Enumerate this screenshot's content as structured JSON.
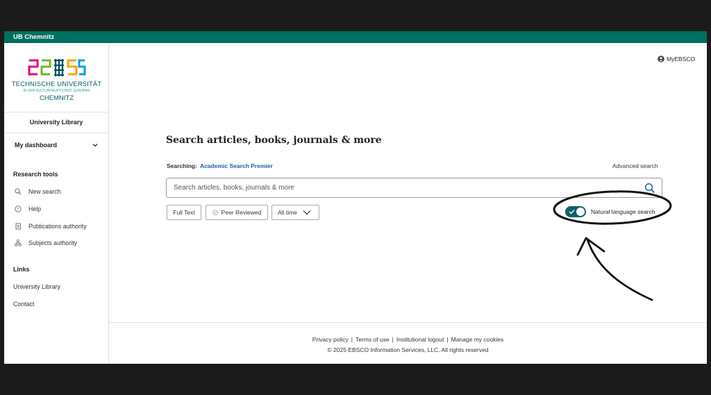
{
  "topbar": {
    "title": "UB Chemnitz"
  },
  "logo": {
    "line1": "TECHNISCHE UNIVERSITÄT",
    "line2": "IN DER KULTURHAUPTSTADT EUROPAS",
    "line3": "CHEMNITZ"
  },
  "sidebar": {
    "library_title": "University Library",
    "dashboard_label": "My dashboard",
    "research_tools_heading": "Research tools",
    "research_tools": [
      {
        "label": "New search",
        "icon": "search-icon"
      },
      {
        "label": "Help",
        "icon": "help-icon"
      },
      {
        "label": "Publications authority",
        "icon": "book-icon"
      },
      {
        "label": "Subjects authority",
        "icon": "hierarchy-icon"
      }
    ],
    "links_heading": "Links",
    "links": [
      {
        "label": "University Library"
      },
      {
        "label": "Contact"
      }
    ]
  },
  "header": {
    "account_label": "MyEBSCO"
  },
  "main": {
    "heading": "Search articles, books, journals & more",
    "searching_label": "Searching:",
    "database": "Academic Search Premier",
    "advanced_search": "Advanced search",
    "search": {
      "placeholder": "Search articles, books, journals & more",
      "value": ""
    },
    "filters": {
      "full_text": "Full Text",
      "peer_reviewed": "Peer Reviewed",
      "time": "All time"
    },
    "natural_language": {
      "label": "Natural language search",
      "enabled": true
    }
  },
  "footer": {
    "links": [
      "Privacy policy",
      "Terms of use",
      "Institutional logout",
      "Manage my cookies"
    ],
    "copyright": "© 2025 EBSCO Information Services, LLC. All rights reserved"
  },
  "colors": {
    "topbar": "#00705f",
    "toggle": "#0d6269",
    "link": "#1f5ea8",
    "backdrop": "#1b1b1b"
  }
}
